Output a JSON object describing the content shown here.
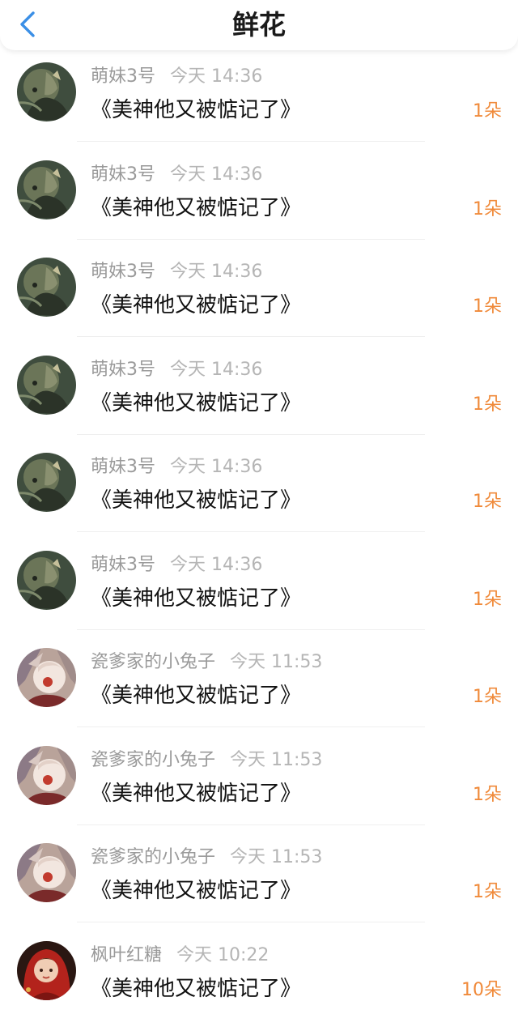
{
  "header": {
    "title": "鲜花",
    "back_icon": "chevron-left-icon",
    "accent_color": "#3b8fe6"
  },
  "flowers": [
    {
      "user": "萌妹3号",
      "time": "今天 14:36",
      "book": "《美神他又被惦记了》",
      "count": "1朵",
      "avatar": "dark-anime-avatar"
    },
    {
      "user": "萌妹3号",
      "time": "今天 14:36",
      "book": "《美神他又被惦记了》",
      "count": "1朵",
      "avatar": "dark-anime-avatar"
    },
    {
      "user": "萌妹3号",
      "time": "今天 14:36",
      "book": "《美神他又被惦记了》",
      "count": "1朵",
      "avatar": "dark-anime-avatar"
    },
    {
      "user": "萌妹3号",
      "time": "今天 14:36",
      "book": "《美神他又被惦记了》",
      "count": "1朵",
      "avatar": "dark-anime-avatar"
    },
    {
      "user": "萌妹3号",
      "time": "今天 14:36",
      "book": "《美神他又被惦记了》",
      "count": "1朵",
      "avatar": "dark-anime-avatar"
    },
    {
      "user": "萌妹3号",
      "time": "今天 14:36",
      "book": "《美神他又被惦记了》",
      "count": "1朵",
      "avatar": "dark-anime-avatar"
    },
    {
      "user": "瓷爹家的小兔子",
      "time": "今天 11:53",
      "book": "《美神他又被惦记了》",
      "count": "1朵",
      "avatar": "pale-anime-avatar"
    },
    {
      "user": "瓷爹家的小兔子",
      "time": "今天 11:53",
      "book": "《美神他又被惦记了》",
      "count": "1朵",
      "avatar": "pale-anime-avatar"
    },
    {
      "user": "瓷爹家的小兔子",
      "time": "今天 11:53",
      "book": "《美神他又被惦记了》",
      "count": "1朵",
      "avatar": "pale-anime-avatar"
    },
    {
      "user": "枫叶红糖",
      "time": "今天 10:22",
      "book": "《美神他又被惦记了》",
      "count": "10朵",
      "avatar": "red-hood-girl-avatar"
    }
  ],
  "colors": {
    "count": "#f08a3a",
    "username": "#9a9a9a",
    "timestamp": "#b5b5b5"
  }
}
